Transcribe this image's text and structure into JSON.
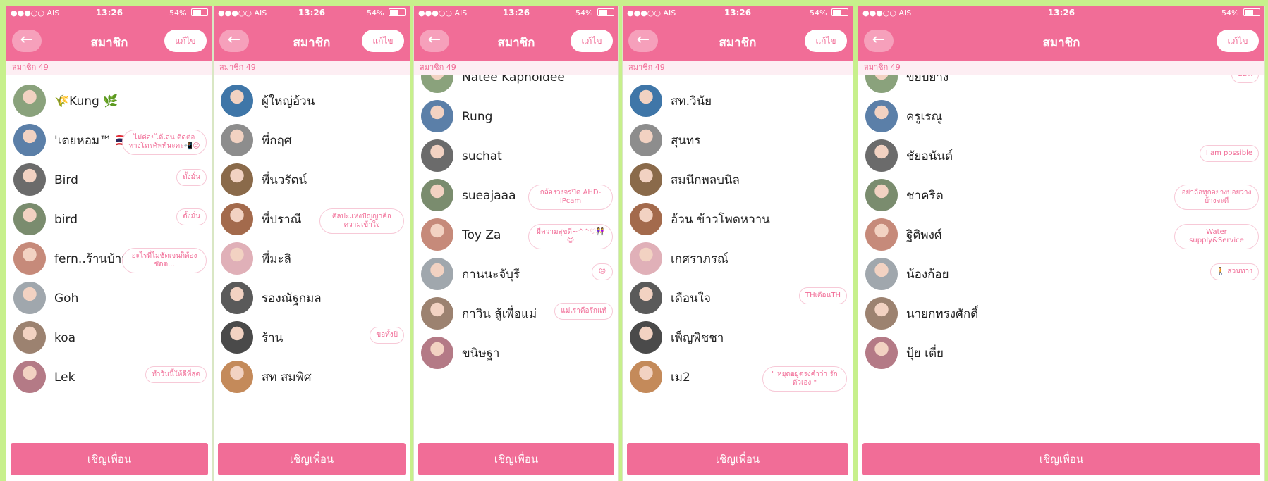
{
  "status_bar": {
    "carrier": "●●●○○ AIS",
    "time": "13:26",
    "battery": "54%"
  },
  "nav": {
    "back_icon": "←",
    "title": "สมาชิก",
    "edit_label": "แก้ไข"
  },
  "section_label": "สมาชิก 49",
  "invite_label": "เชิญเพื่อน",
  "panels": [
    {
      "rows": [
        {
          "name": "🌾Kung 🌿",
          "status": ""
        },
        {
          "name": "'เตยหอม™ 🇹🇭",
          "status": "ไม่ค่อยได้เล่น ติดต่อทางโทรศัพท์นะคะ📲😊"
        },
        {
          "name": "Bird",
          "status": "ตั้งมั่น"
        },
        {
          "name": "bird",
          "status": "ตั้งมั่น"
        },
        {
          "name": "fern..ร้านบ้านยา😘😘",
          "status": "อะไรที่ไม่ชัดเจนก็ต้องชัดต..."
        },
        {
          "name": "Goh",
          "status": ""
        },
        {
          "name": "koa",
          "status": ""
        },
        {
          "name": "Lek",
          "status": "ทำวันนี้ให้ดีที่สุด"
        }
      ]
    },
    {
      "rows": [
        {
          "name": "ผู้ใหญ่อ้วน",
          "status": ""
        },
        {
          "name": "พี่กฤศ",
          "status": ""
        },
        {
          "name": "พี่นวรัตน์",
          "status": ""
        },
        {
          "name": "พี่ปราณี",
          "status": "ศิลปะแห่งปัญญาคือความเข้าใจ"
        },
        {
          "name": "พี่มะลิ",
          "status": ""
        },
        {
          "name": "รองณัฐกมล",
          "status": ""
        },
        {
          "name": "ร้าน",
          "status": "ขอทั้งปี"
        },
        {
          "name": "สท สมพิศ",
          "status": ""
        }
      ]
    },
    {
      "rows": [
        {
          "name": "Natee Kapholdee",
          "status": ""
        },
        {
          "name": "Rung",
          "status": ""
        },
        {
          "name": "suchat",
          "status": ""
        },
        {
          "name": "sueajaaa",
          "status": "กล้องวงจรปิด AHD-IPcam"
        },
        {
          "name": "Toy Za",
          "status": "มีความสุขดี~^^♡👭😊"
        },
        {
          "name": "กานนะจับุรี",
          "status": "😣"
        },
        {
          "name": "กาวิน สู้เพื่อแม่",
          "status": "แม่เราคือรักแท้"
        },
        {
          "name": "ขนิษฐา",
          "status": ""
        }
      ]
    },
    {
      "rows": [
        {
          "name": "สท.วินัย",
          "status": ""
        },
        {
          "name": "สุนทร",
          "status": ""
        },
        {
          "name": "สมนึกพลบนิล",
          "status": ""
        },
        {
          "name": "อ้วน ข้าวโพดหวาน",
          "status": ""
        },
        {
          "name": "เกศราภรณ์",
          "status": ""
        },
        {
          "name": "เดือนใจ",
          "status": "THเดือนTH"
        },
        {
          "name": "เพ็ญพิชชา",
          "status": ""
        },
        {
          "name": "เม2",
          "status": "\" หยุดอยู่ตรงคำว่า รักตัวเอง \""
        }
      ]
    },
    {
      "rows": [
        {
          "name": "ขยับยาง",
          "status": "EDK"
        },
        {
          "name": "ครูเรณู",
          "status": ""
        },
        {
          "name": "ชัยอนันต์",
          "status": "I am possible"
        },
        {
          "name": "ชาคริต",
          "status": "อย่าถือทุกอย่างบ่อยว่างบ้างจะดี"
        },
        {
          "name": "ฐิติพงศ์",
          "status": "Water supply&Service"
        },
        {
          "name": "น้องก้อย",
          "status": "🚶 สวนทาง"
        },
        {
          "name": "นายกทรงศักดิ์",
          "status": ""
        },
        {
          "name": "ปุ้ย เตี่ย",
          "status": ""
        }
      ]
    }
  ],
  "avatar_colors": [
    "#8aa27c",
    "#5b7fa8",
    "#6b6b6b",
    "#7a8c6e",
    "#c68a7a",
    "#a0a7ad",
    "#9c8270",
    "#b47a86",
    "#3f76a8",
    "#8d8d8d",
    "#8a6a4a",
    "#a36a4c",
    "#e0b0b8",
    "#5a5a5a",
    "#4a4a4a",
    "#c48a5a"
  ],
  "accent": "#f16d97"
}
